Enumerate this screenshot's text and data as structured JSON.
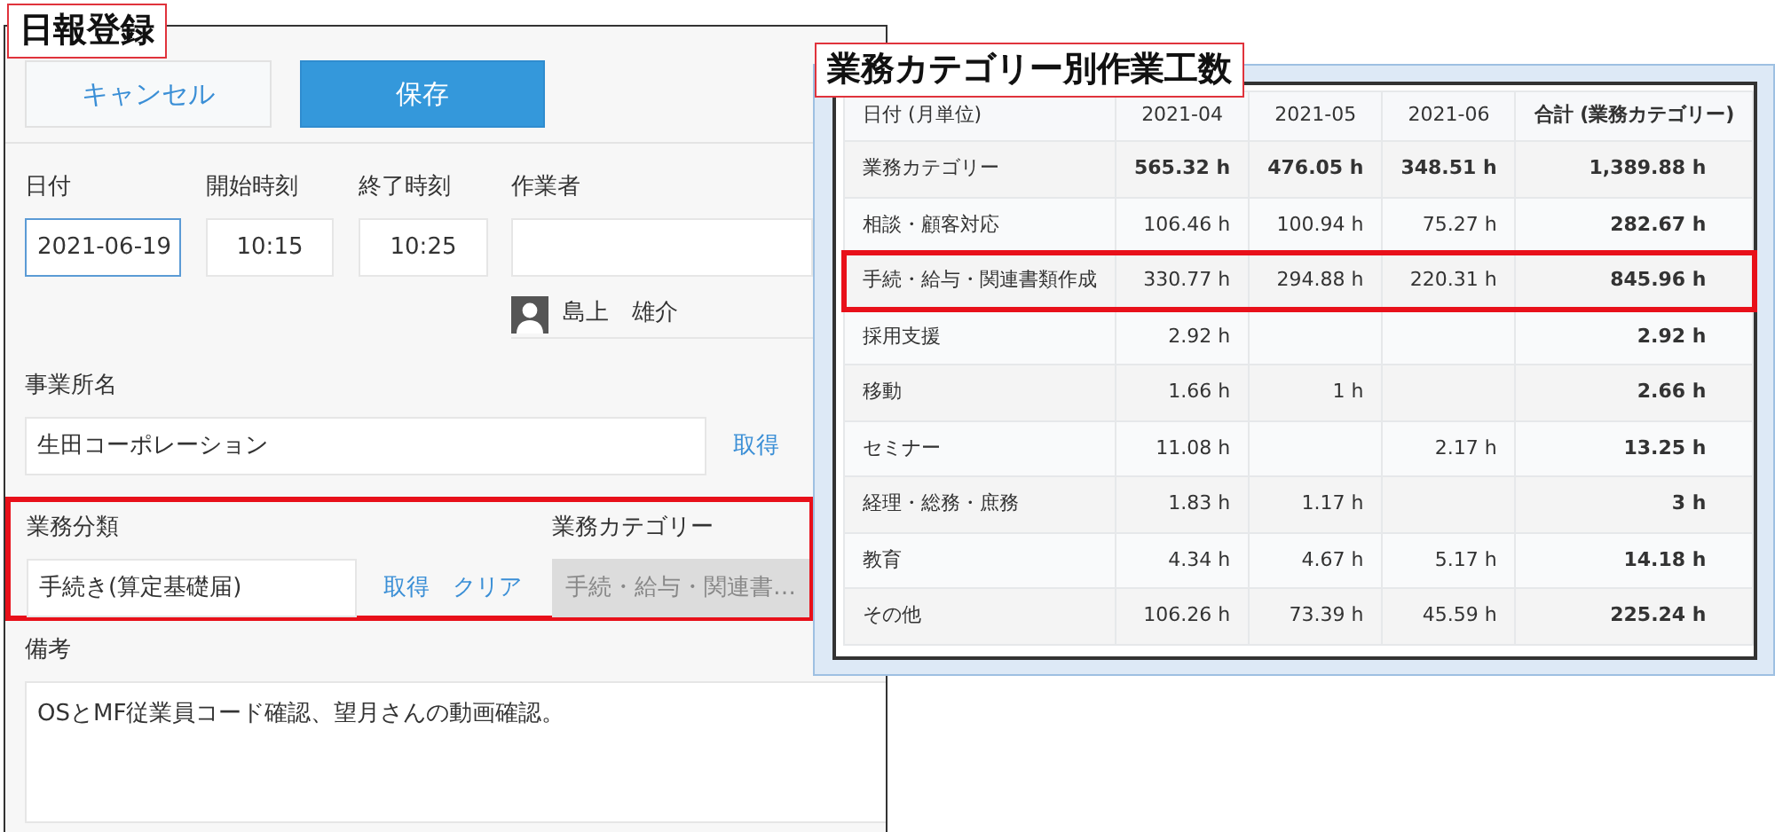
{
  "daily_report": {
    "title": "日報登録",
    "cancel_button": "キャンセル",
    "save_button": "保存",
    "date": {
      "label": "日付",
      "value": "2021-06-19",
      "focused": true
    },
    "start_time": {
      "label": "開始時刻",
      "value": "10:15"
    },
    "end_time": {
      "label": "終了時刻",
      "value": "10:25"
    },
    "worker": {
      "label": "作業者",
      "user": "島上　雄介"
    },
    "office": {
      "label": "事業所名",
      "value": "生田コーポレーション",
      "links": [
        "取得"
      ]
    },
    "task_type": {
      "label": "業務分類",
      "value": "手続き(算定基礎届)",
      "links": [
        "取得",
        "クリア"
      ],
      "highlighted": true
    },
    "task_category": {
      "label": "業務カテゴリー",
      "value": "手続・給与・関連書…",
      "disabled": true
    },
    "notes": {
      "label": "備考",
      "value": "OSとMF従業員コード確認、望月さんの動画確認。"
    }
  },
  "hours_table": {
    "title": "業務カテゴリー別作業工数",
    "columns": [
      "日付 (月単位)",
      "2021-04",
      "2021-05",
      "2021-06",
      "合計 (業務カテゴリー)"
    ],
    "rows": [
      {
        "cells": [
          "業務カテゴリー",
          "565.32 h",
          "476.05 h",
          "348.51 h",
          "1,389.88 h"
        ],
        "summary": true,
        "highlighted": false
      },
      {
        "cells": [
          "相談・顧客対応",
          "106.46 h",
          "100.94 h",
          "75.27 h",
          "282.67 h"
        ],
        "summary": false,
        "highlighted": false
      },
      {
        "cells": [
          "手続・給与・関連書類作成",
          "330.77 h",
          "294.88 h",
          "220.31 h",
          "845.96 h"
        ],
        "summary": false,
        "highlighted": true
      },
      {
        "cells": [
          "採用支援",
          "2.92 h",
          null,
          null,
          "2.92 h"
        ],
        "summary": false,
        "highlighted": false
      },
      {
        "cells": [
          "移動",
          "1.66 h",
          "1 h",
          null,
          "2.66 h"
        ],
        "summary": false,
        "highlighted": false
      },
      {
        "cells": [
          "セミナー",
          "11.08 h",
          null,
          "2.17 h",
          "13.25 h"
        ],
        "summary": false,
        "highlighted": false
      },
      {
        "cells": [
          "経理・総務・庶務",
          "1.83 h",
          "1.17 h",
          null,
          "3 h"
        ],
        "summary": false,
        "highlighted": false
      },
      {
        "cells": [
          "教育",
          "4.34 h",
          "4.67 h",
          "5.17 h",
          "14.18 h"
        ],
        "summary": false,
        "highlighted": false
      },
      {
        "cells": [
          "その他",
          "106.26 h",
          "73.39 h",
          "45.59 h",
          "225.24 h"
        ],
        "summary": false,
        "highlighted": false
      }
    ]
  }
}
